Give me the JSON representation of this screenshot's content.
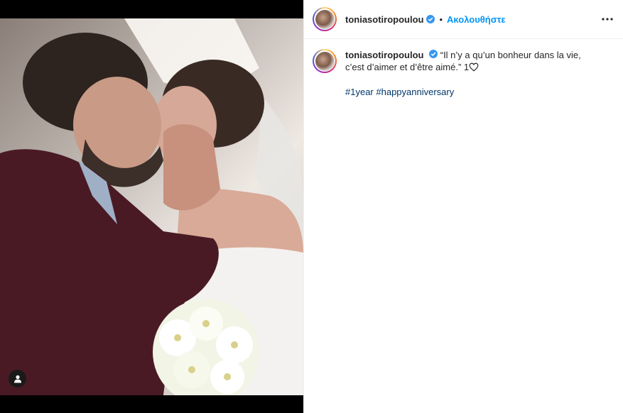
{
  "post": {
    "username": "toniasotiropoulou",
    "follow_label": "Ακολουθήστε",
    "separator": "•",
    "caption": {
      "username": "toniasotiropoulou",
      "text": "“Il n’y a qu’un bonheur dans la vie, c’est d’aimer et d’être aimé.” 1",
      "hashtags": [
        "#1year",
        "#happyanniversary"
      ]
    }
  },
  "icons": {
    "verified": "verified-badge-icon",
    "more": "more-options-icon",
    "user_tag": "user-tag-icon",
    "heart": "heart-outline-icon"
  },
  "colors": {
    "follow_blue": "#0095f6",
    "hashtag_blue": "#00376b",
    "verified_blue": "#3897f0",
    "text": "#262626"
  }
}
